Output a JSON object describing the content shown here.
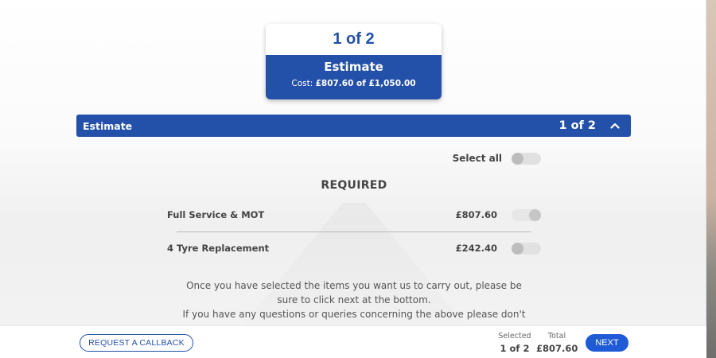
{
  "summary": {
    "progress": "1 of 2",
    "title": "Estimate",
    "cost_prefix": "Cost: ",
    "cost_value": "£807.60 of £1,050.00"
  },
  "estimate_section": {
    "label": "Estimate",
    "count": "1 of 2",
    "chevron": "^"
  },
  "select_all": {
    "label": "Select all",
    "checked": false
  },
  "group_heading": "REQUIRED",
  "items": [
    {
      "name": "Full Service & MOT",
      "price": "£807.60",
      "checked": true
    },
    {
      "name": "4 Tyre Replacement",
      "price": "£242.40",
      "checked": false
    }
  ],
  "note_lines": [
    "Once you have selected the items you want us to carry out, please be",
    "sure to click next at the bottom.",
    "If you have any questions or queries concerning the above please don't"
  ],
  "footer": {
    "callback_label": "REQUEST A CALLBACK",
    "selected_caption": "Selected",
    "selected_value": "1 of 2",
    "total_caption": "Total",
    "total_value": "£807.60",
    "next_label": "NEXT"
  },
  "colors": {
    "brand_blue": "#2350a8",
    "button_blue": "#1f5bd6"
  }
}
